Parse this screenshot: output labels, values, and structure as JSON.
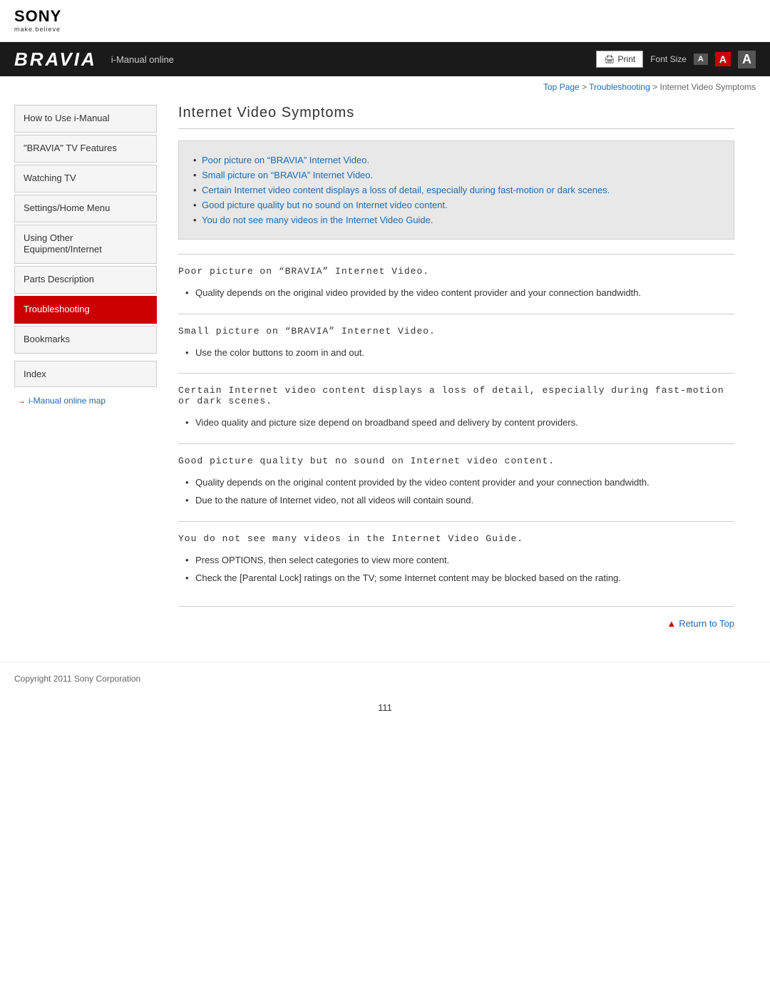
{
  "header": {
    "sony_logo": "SONY",
    "sony_tagline": "make.believe",
    "bravia_logo": "BRAVIA",
    "imanual_text": "i-Manual online",
    "print_label": "Print",
    "font_size_label": "Font Size",
    "font_sizes": [
      "A",
      "A",
      "A"
    ]
  },
  "breadcrumb": {
    "top_page": "Top Page",
    "separator1": " > ",
    "troubleshooting": "Troubleshooting",
    "separator2": " > ",
    "current": "Internet Video Symptoms"
  },
  "sidebar": {
    "items": [
      {
        "label": "How to Use i-Manual",
        "active": false
      },
      {
        "label": "\"BRAVIA\" TV Features",
        "active": false
      },
      {
        "label": "Watching TV",
        "active": false
      },
      {
        "label": "Settings/Home Menu",
        "active": false
      },
      {
        "label": "Using Other Equipment/Internet",
        "active": false
      },
      {
        "label": "Parts Description",
        "active": false
      },
      {
        "label": "Troubleshooting",
        "active": true
      },
      {
        "label": "Bookmarks",
        "active": false
      }
    ],
    "index_label": "Index",
    "map_link": "i-Manual online map"
  },
  "content": {
    "page_title": "Internet Video Symptoms",
    "summary_links": [
      "Poor picture on “BRAVIA” Internet Video.",
      "Small picture on “BRAVIA” Internet Video.",
      "Certain Internet video content displays a loss of detail, especially during fast-motion or dark scenes.",
      "Good picture quality but no sound on Internet video content.",
      "You do not see many videos in the Internet Video Guide."
    ],
    "sections": [
      {
        "title": "Poor picture on “BRAVIA” Internet Video.",
        "bullets": [
          "Quality depends on the original video provided by the video content provider and your connection bandwidth."
        ]
      },
      {
        "title": "Small picture on “BRAVIA” Internet Video.",
        "bullets": [
          "Use the color buttons to zoom in and out."
        ]
      },
      {
        "title": "Certain Internet video content displays a loss of detail, especially during fast-motion or dark scenes.",
        "bullets": [
          "Video quality and picture size depend on broadband speed and delivery by content providers."
        ]
      },
      {
        "title": "Good picture quality but no sound on Internet video content.",
        "bullets": [
          "Quality depends on the original content provided by the video content provider and your connection bandwidth.",
          "Due to the nature of Internet video, not all videos will contain sound."
        ]
      },
      {
        "title": "You do not see many videos in the Internet Video Guide.",
        "bullets": [
          "Press OPTIONS, then select categories to view more content.",
          "Check the [Parental Lock] ratings on the TV; some Internet content may be blocked based on the rating."
        ]
      }
    ],
    "return_to_top": "Return to Top"
  },
  "footer": {
    "copyright": "Copyright 2011 Sony Corporation",
    "page_number": "111"
  }
}
